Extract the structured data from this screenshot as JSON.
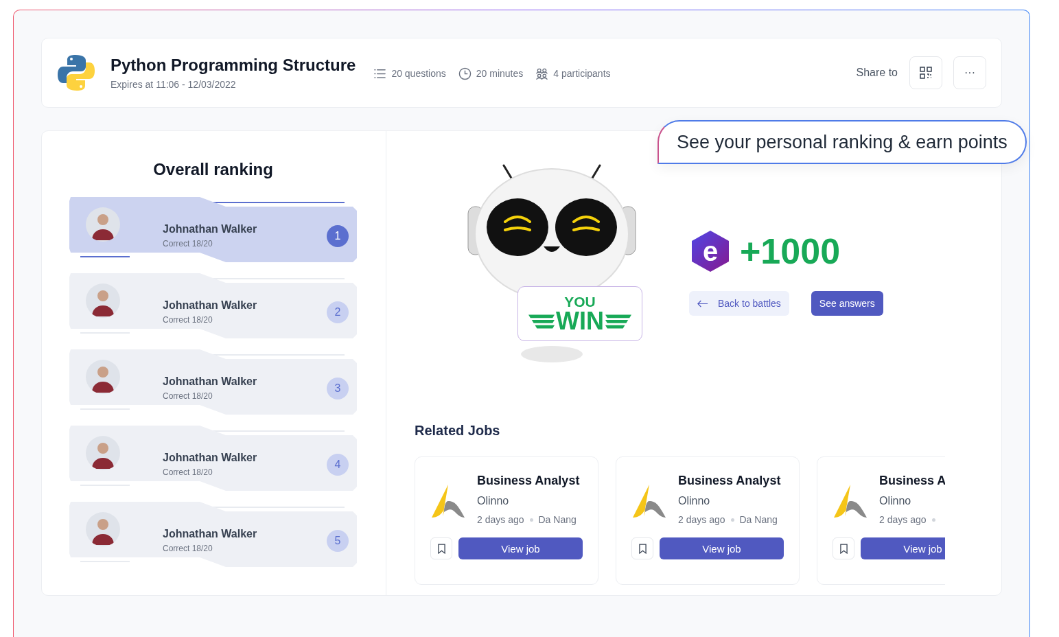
{
  "quiz": {
    "title": "Python Programming Structure",
    "expires": "Expires at 11:06 - 12/03/2022",
    "stats": [
      {
        "kind": "questions",
        "text": "20 questions"
      },
      {
        "kind": "time",
        "text": "20 minutes"
      },
      {
        "kind": "people",
        "text": "4 participants"
      }
    ],
    "share_label": "Share to",
    "more_label": "···"
  },
  "callout": "See your personal ranking & earn points",
  "ranking": {
    "title": "Overall ranking",
    "rows": [
      {
        "name": "Johnathan Walker",
        "score": "Correct 18/20",
        "rank": "1",
        "selected": true
      },
      {
        "name": "Johnathan Walker",
        "score": "Correct 18/20",
        "rank": "2",
        "selected": false
      },
      {
        "name": "Johnathan Walker",
        "score": "Correct 18/20",
        "rank": "3",
        "selected": false
      },
      {
        "name": "Johnathan Walker",
        "score": "Correct 18/20",
        "rank": "4",
        "selected": false
      },
      {
        "name": "Johnathan Walker",
        "score": "Correct 18/20",
        "rank": "5",
        "selected": false
      }
    ]
  },
  "result": {
    "sign_top": "YOU",
    "sign_main": "WIN",
    "coin_letter": "e",
    "points": "+1000",
    "back_button": "Back to battles",
    "answers_button": "See answers"
  },
  "jobs": {
    "title": "Related Jobs",
    "cards": [
      {
        "title": "Business Analyst",
        "company": "Olinno",
        "posted": "2 days ago",
        "location": "Da Nang",
        "button": "View job"
      },
      {
        "title": "Business Analyst",
        "company": "Olinno",
        "posted": "2 days ago",
        "location": "Da Nang",
        "button": "View job"
      },
      {
        "title": "Business A",
        "company": "Olinno",
        "posted": "2 days ago",
        "button": "View job"
      }
    ]
  }
}
